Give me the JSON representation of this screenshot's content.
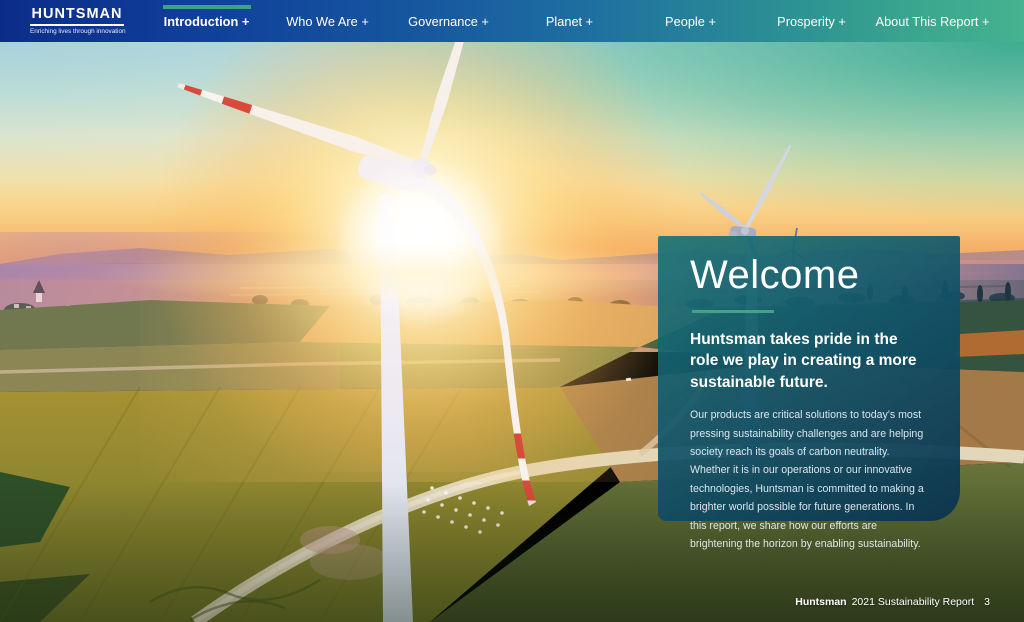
{
  "nav": {
    "logo": {
      "brand": "HUNTSMAN",
      "tagline": "Enriching lives through innovation"
    },
    "items": [
      {
        "label": "Introduction +",
        "active": true
      },
      {
        "label": "Who We Are +",
        "active": false
      },
      {
        "label": "Governance +",
        "active": false
      },
      {
        "label": "Planet +",
        "active": false
      },
      {
        "label": "People +",
        "active": false
      },
      {
        "label": "Prosperity +",
        "active": false
      },
      {
        "label": "About This Report +",
        "active": false
      }
    ]
  },
  "hero": {
    "image_description": "Aerial photo of wind turbines above patchwork farm fields at sunset",
    "welcome": {
      "title": "Welcome",
      "lead": "Huntsman takes pride in the role we play in creating a more sustainable future.",
      "body": "Our products are critical solutions to today's most pressing sustainability challenges and are helping society reach its goals of carbon neutrality. Whether it is in our operations or our innovative technologies, Huntsman is committed to making a brighter world possible for future generations. In this report, we share how our efforts are brightening the horizon by enabling sustainability."
    }
  },
  "footer": {
    "brand": "Huntsman",
    "report_title": "2021 Sustainability Report",
    "page_number": "3"
  },
  "colors": {
    "nav_gradient_start": "#0b2d89",
    "nav_gradient_end": "#46b290",
    "active_tab_indicator": "#3aa57b",
    "welcome_rule_accent": "#44a287",
    "card_teal": "#1a7679",
    "card_deep_blue": "#0b334f"
  }
}
